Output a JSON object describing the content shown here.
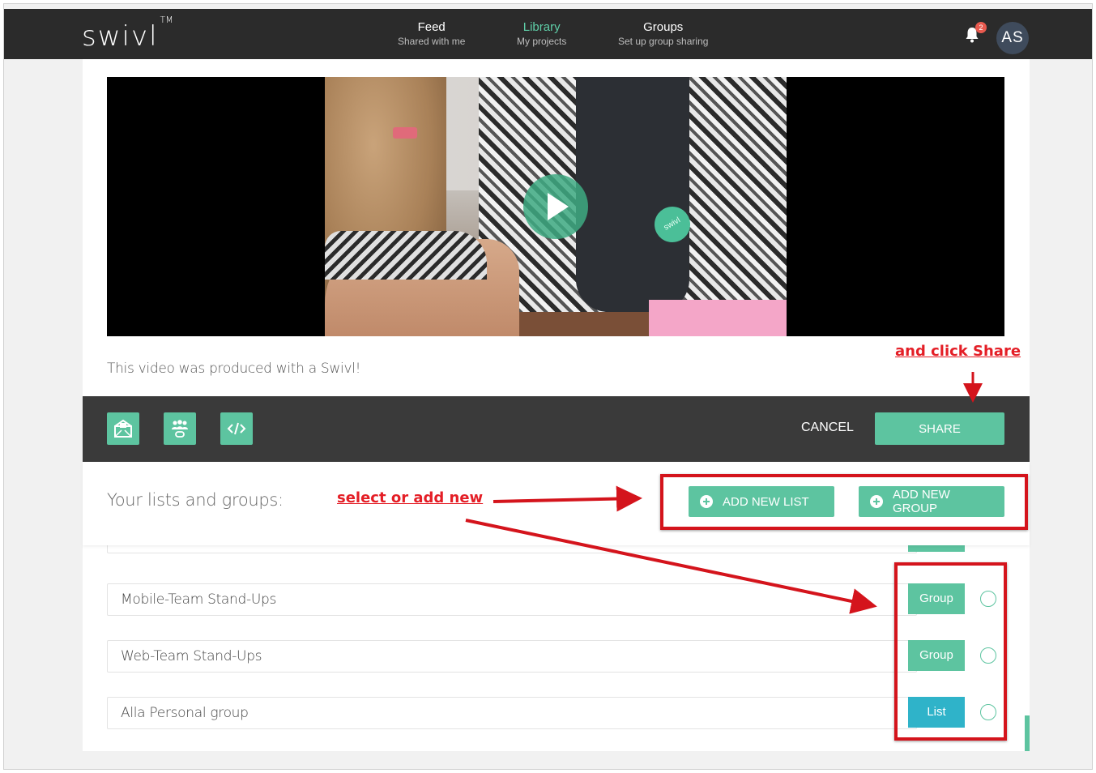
{
  "app": {
    "logo": "swivl",
    "trademark": "TM"
  },
  "nav": [
    {
      "title": "Feed",
      "sub": "Shared with me"
    },
    {
      "title": "Library",
      "sub": "My projects"
    },
    {
      "title": "Groups",
      "sub": "Set up group sharing"
    }
  ],
  "header": {
    "notification_count": "2",
    "avatar_initials": "AS"
  },
  "video": {
    "caption": "This video was produced with a Swivl!",
    "pin_text": "swivl"
  },
  "sharebar": {
    "icons": [
      "email-share-icon",
      "group-share-icon",
      "embed-code-icon"
    ],
    "cancel_label": "CANCEL",
    "share_label": "SHARE"
  },
  "lists": {
    "heading": "Your lists and groups:",
    "add_list_label": "ADD NEW LIST",
    "add_group_label": "ADD NEW GROUP",
    "rows": [
      {
        "name": "Mobile-Team Stand-Ups",
        "type": "Group"
      },
      {
        "name": "Web-Team Stand-Ups",
        "type": "Group"
      },
      {
        "name": "Alla Personal group",
        "type": "List"
      }
    ]
  },
  "annotations": {
    "share_hint": "and click Share",
    "select_hint": "select or add new"
  },
  "colors": {
    "accent": "#5dc4a0",
    "list_tag": "#2fb3c9",
    "topbar": "#2b2b2b",
    "annotation": "#e41e26"
  }
}
